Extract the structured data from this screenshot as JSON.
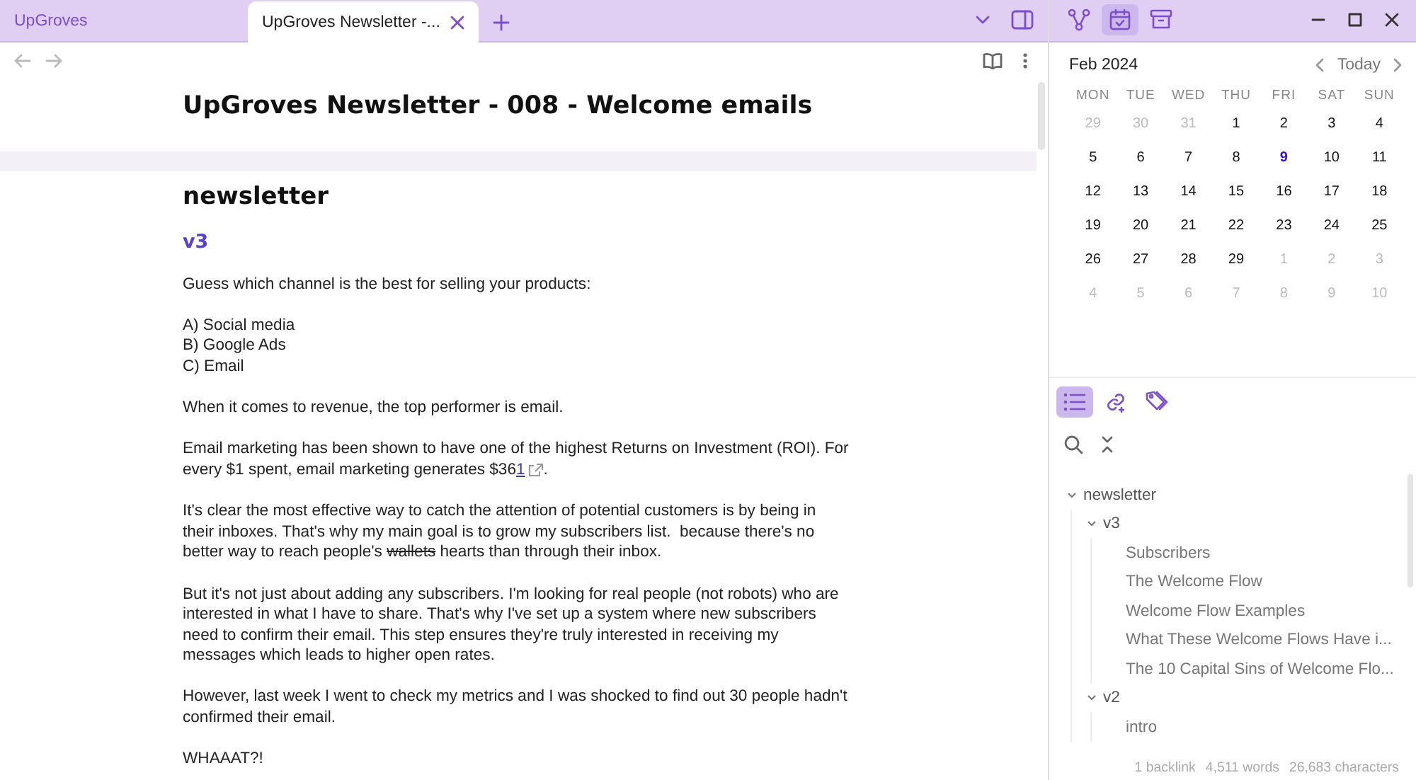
{
  "tabs": [
    {
      "label": "UpGroves",
      "selected": false
    },
    {
      "label": "UpGroves Newsletter -...",
      "selected": true
    }
  ],
  "sidebar_tabs": [
    {
      "kind": "graph",
      "selected": false
    },
    {
      "kind": "calendar",
      "selected": true
    },
    {
      "kind": "archive",
      "selected": false
    }
  ],
  "note": {
    "title": "UpGroves Newsletter - 008 - Welcome emails",
    "heading": "newsletter",
    "subheading": "v3",
    "paragraphs": [
      [
        {
          "kind": "text",
          "text": "Guess which channel is the best for selling your products:"
        }
      ],
      [
        {
          "kind": "text",
          "text": "A) Social media\nB) Google Ads\nC) Email"
        }
      ],
      [
        {
          "kind": "text",
          "text": "When it comes to revenue, the top performer is email."
        }
      ],
      [
        {
          "kind": "text",
          "text": "Email marketing has been shown to have one of the highest Returns on Investment (ROI). For every $1 spent, email marketing generates $36"
        },
        {
          "kind": "link",
          "text": "1"
        },
        {
          "kind": "text",
          "text": "."
        }
      ],
      [
        {
          "kind": "text",
          "text": "It's clear the most effective way to catch the attention of potential customers is by being in their inboxes. That's why my main goal is to grow my subscribers list.  because there's no better way to reach people's "
        },
        {
          "kind": "struck",
          "text": "wallets"
        },
        {
          "kind": "text",
          "text": " hearts than through their inbox."
        }
      ],
      [
        {
          "kind": "text",
          "text": "But it's not just about adding any subscribers. I'm looking for real people (not robots) who are interested in what I have to share. That's why I've set up a system where new subscribers need to confirm their email. This step ensures they're truly interested in receiving my messages which leads to higher open rates."
        }
      ],
      [
        {
          "kind": "text",
          "text": "However, last week I went to check my metrics and I was shocked to find out 30 people hadn't confirmed their email."
        }
      ],
      [
        {
          "kind": "text",
          "text": "WHAAAT?!"
        }
      ]
    ]
  },
  "calendar": {
    "month": "Feb 2024",
    "today_button": "Today",
    "weekdays": [
      "MON",
      "TUE",
      "WED",
      "THU",
      "FRI",
      "SAT",
      "SUN"
    ],
    "weeks": [
      [
        {
          "day": "29",
          "muted": true,
          "today": false
        },
        {
          "day": "30",
          "muted": true,
          "today": false
        },
        {
          "day": "31",
          "muted": true,
          "today": false
        },
        {
          "day": "1",
          "muted": false,
          "today": false
        },
        {
          "day": "2",
          "muted": false,
          "today": false
        },
        {
          "day": "3",
          "muted": false,
          "today": false
        },
        {
          "day": "4",
          "muted": false,
          "today": false
        }
      ],
      [
        {
          "day": "5",
          "muted": false,
          "today": false
        },
        {
          "day": "6",
          "muted": false,
          "today": false
        },
        {
          "day": "7",
          "muted": false,
          "today": false
        },
        {
          "day": "8",
          "muted": false,
          "today": false
        },
        {
          "day": "9",
          "muted": false,
          "today": true
        },
        {
          "day": "10",
          "muted": false,
          "today": false
        },
        {
          "day": "11",
          "muted": false,
          "today": false
        }
      ],
      [
        {
          "day": "12",
          "muted": false,
          "today": false
        },
        {
          "day": "13",
          "muted": false,
          "today": false
        },
        {
          "day": "14",
          "muted": false,
          "today": false
        },
        {
          "day": "15",
          "muted": false,
          "today": false
        },
        {
          "day": "16",
          "muted": false,
          "today": false
        },
        {
          "day": "17",
          "muted": false,
          "today": false
        },
        {
          "day": "18",
          "muted": false,
          "today": false
        }
      ],
      [
        {
          "day": "19",
          "muted": false,
          "today": false
        },
        {
          "day": "20",
          "muted": false,
          "today": false
        },
        {
          "day": "21",
          "muted": false,
          "today": false
        },
        {
          "day": "22",
          "muted": false,
          "today": false
        },
        {
          "day": "23",
          "muted": false,
          "today": false
        },
        {
          "day": "24",
          "muted": false,
          "today": false
        },
        {
          "day": "25",
          "muted": false,
          "today": false
        }
      ],
      [
        {
          "day": "26",
          "muted": false,
          "today": false
        },
        {
          "day": "27",
          "muted": false,
          "today": false
        },
        {
          "day": "28",
          "muted": false,
          "today": false
        },
        {
          "day": "29",
          "muted": false,
          "today": false
        },
        {
          "day": "1",
          "muted": true,
          "today": false
        },
        {
          "day": "2",
          "muted": true,
          "today": false
        },
        {
          "day": "3",
          "muted": true,
          "today": false
        }
      ],
      [
        {
          "day": "4",
          "muted": true,
          "today": false
        },
        {
          "day": "5",
          "muted": true,
          "today": false
        },
        {
          "day": "6",
          "muted": true,
          "today": false
        },
        {
          "day": "7",
          "muted": true,
          "today": false
        },
        {
          "day": "8",
          "muted": true,
          "today": false
        },
        {
          "day": "9",
          "muted": true,
          "today": false
        },
        {
          "day": "10",
          "muted": true,
          "today": false
        }
      ]
    ]
  },
  "outline_tabs": [
    {
      "kind": "outline",
      "selected": true
    },
    {
      "kind": "links",
      "selected": false
    },
    {
      "kind": "tags",
      "selected": false
    }
  ],
  "outline": [
    {
      "label": "newsletter",
      "expanded": true,
      "children": [
        {
          "label": "v3",
          "expanded": true,
          "children": [
            {
              "label": "Subscribers"
            },
            {
              "label": "The Welcome Flow"
            },
            {
              "label": "Welcome Flow Examples"
            },
            {
              "label": "What These Welcome Flows Have i..."
            },
            {
              "label": "The 10 Capital Sins of Welcome Flo..."
            }
          ]
        },
        {
          "label": "v2",
          "expanded": true,
          "children": [
            {
              "label": "intro"
            }
          ]
        }
      ]
    }
  ],
  "status_bar": [
    "1 backlink",
    "4,511 words",
    "26,683 characters"
  ]
}
